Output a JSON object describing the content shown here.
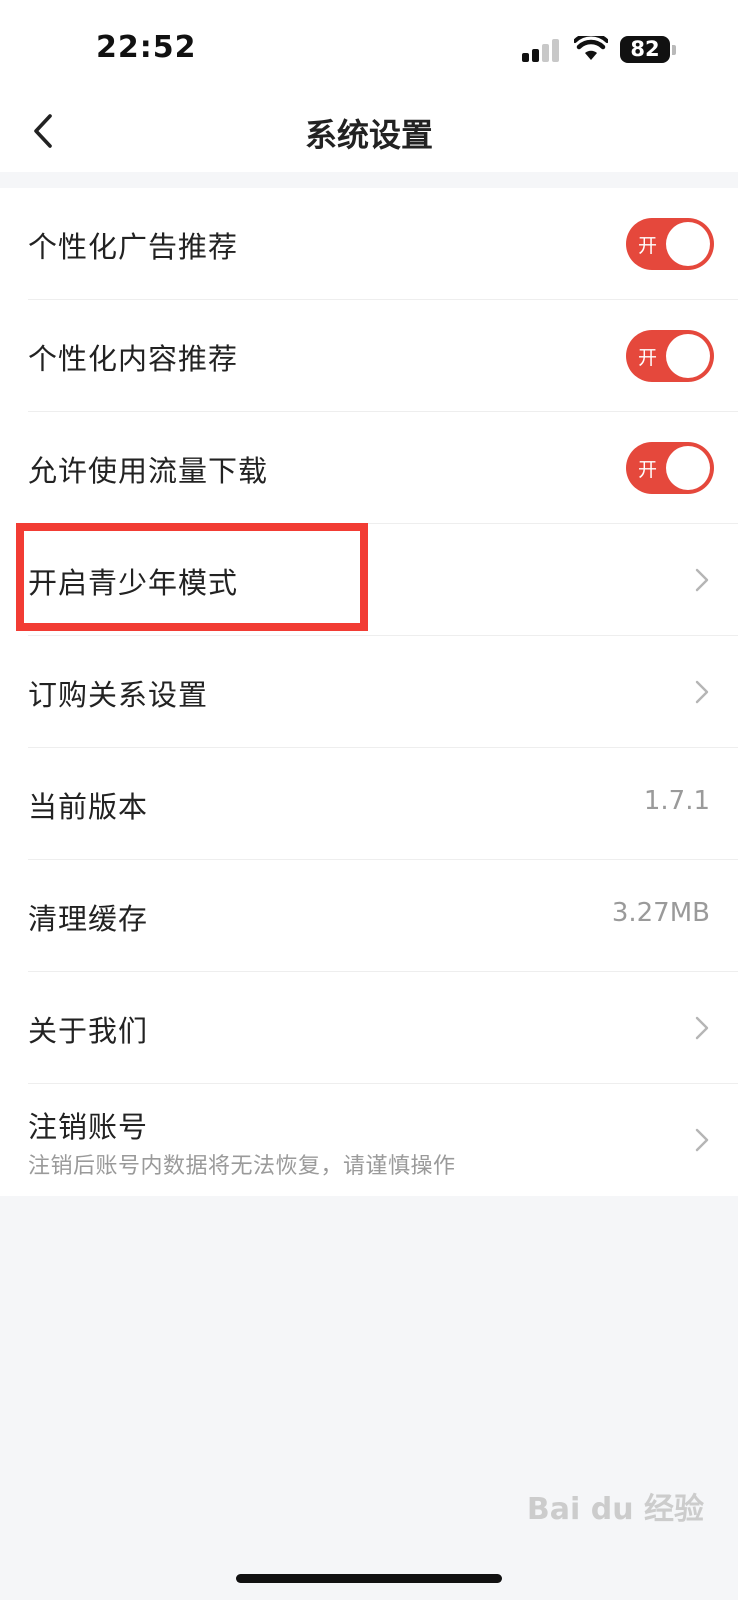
{
  "status_bar": {
    "time": "22:52",
    "battery": "82"
  },
  "nav": {
    "title": "系统设置"
  },
  "settings": {
    "personalized_ads": {
      "label": "个性化广告推荐",
      "toggle_text": "开"
    },
    "personalized_content": {
      "label": "个性化内容推荐",
      "toggle_text": "开"
    },
    "cellular_download": {
      "label": "允许使用流量下载",
      "toggle_text": "开"
    },
    "teen_mode": {
      "label": "开启青少年模式"
    },
    "subscription": {
      "label": "订购关系设置"
    },
    "version": {
      "label": "当前版本",
      "value": "1.7.1"
    },
    "cache": {
      "label": "清理缓存",
      "value": "3.27MB"
    },
    "about": {
      "label": "关于我们"
    },
    "delete_account": {
      "label": "注销账号",
      "sub": "注销后账号内数据将无法恢复，请谨慎操作"
    }
  },
  "watermark": "Bai du 经验",
  "colors": {
    "accent": "#e5483c",
    "highlight": "#f23c34",
    "background": "#f5f6f8"
  },
  "icons": [
    "back-arrow-icon",
    "chevron-right-icon",
    "wifi-icon",
    "signal-icon",
    "battery-icon"
  ]
}
